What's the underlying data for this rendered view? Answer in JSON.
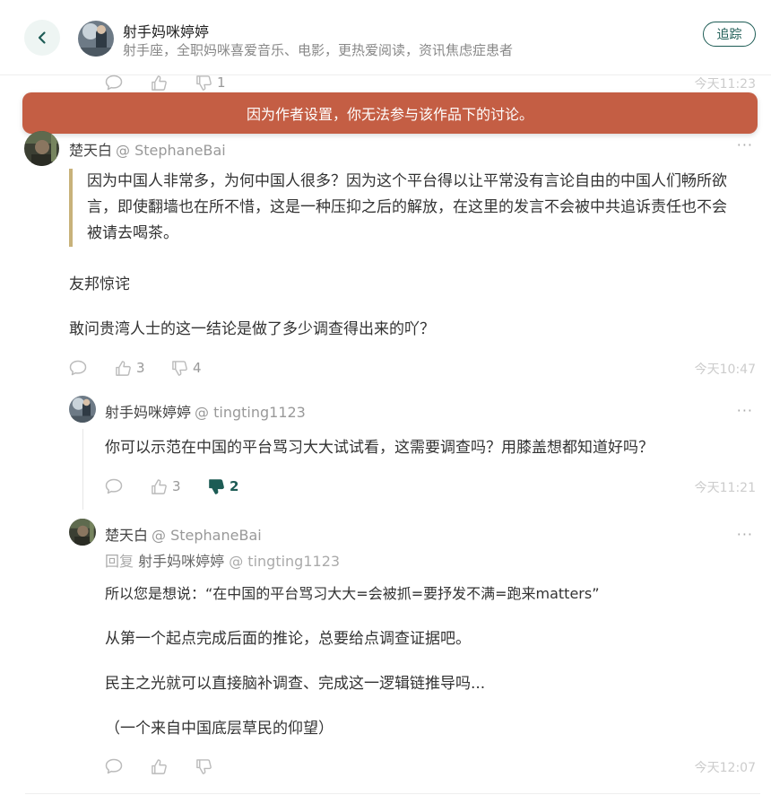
{
  "header": {
    "author_name": "射手妈咪婷婷",
    "author_bio": "射手座，全职妈咪喜爱音乐、电影，更热爱阅读，资讯焦虑症患者",
    "follow_label": "追踪"
  },
  "top_actions": {
    "dislike_count": "1",
    "time": "今天11:23"
  },
  "banner": {
    "text": "因为作者设置，你无法参与该作品下的讨论。"
  },
  "comment1": {
    "name": "楚天白",
    "handle": "@ StephaneBai",
    "quote": "因为中国人非常多，为何中国人很多？因为这个平台得以让平常没有言论自由的中国人们畅所欲言，即使翻墙也在所不惜，这是一种压抑之后的解放，在这里的发言不会被中共追诉责任也不会被请去喝茶。",
    "p1": "友邦惊诧",
    "p2": "敢问贵湾人士的这一结论是做了多少调查得出来的吖？",
    "like_count": "3",
    "dislike_count": "4",
    "time": "今天10:47"
  },
  "reply1": {
    "name": "射手妈咪婷婷",
    "handle": "@ tingting1123",
    "text": "你可以示范在中国的平台骂习大大试试看，这需要调查吗？用膝盖想都知道好吗？",
    "like_count": "3",
    "dislike_count": "2",
    "time": "今天11:21"
  },
  "reply2": {
    "name": "楚天白",
    "handle": "@ StephaneBai",
    "reply_prefix": "回复",
    "reply_to_name": "射手妈咪婷婷",
    "reply_to_handle": "@ tingting1123",
    "p1": "所以您是想说：“在中国的平台骂习大大=会被抓=要抒发不满=跑来matters”",
    "p2": "从第一个起点完成后面的推论，总要给点调查证据吧。",
    "p3": "民主之光就可以直接脑补调查、完成这一逻辑链推导吗...",
    "p4": "（一个来自中国底层草民的仰望）",
    "time": "今天12:07"
  },
  "colors": {
    "accent": "#1d5c55",
    "banner": "#c45e44",
    "quote_bar": "#c8b27a"
  },
  "icons": [
    "chevron-left-icon",
    "comment-icon",
    "thumbs-up-icon",
    "thumbs-down-icon",
    "more-icon"
  ]
}
